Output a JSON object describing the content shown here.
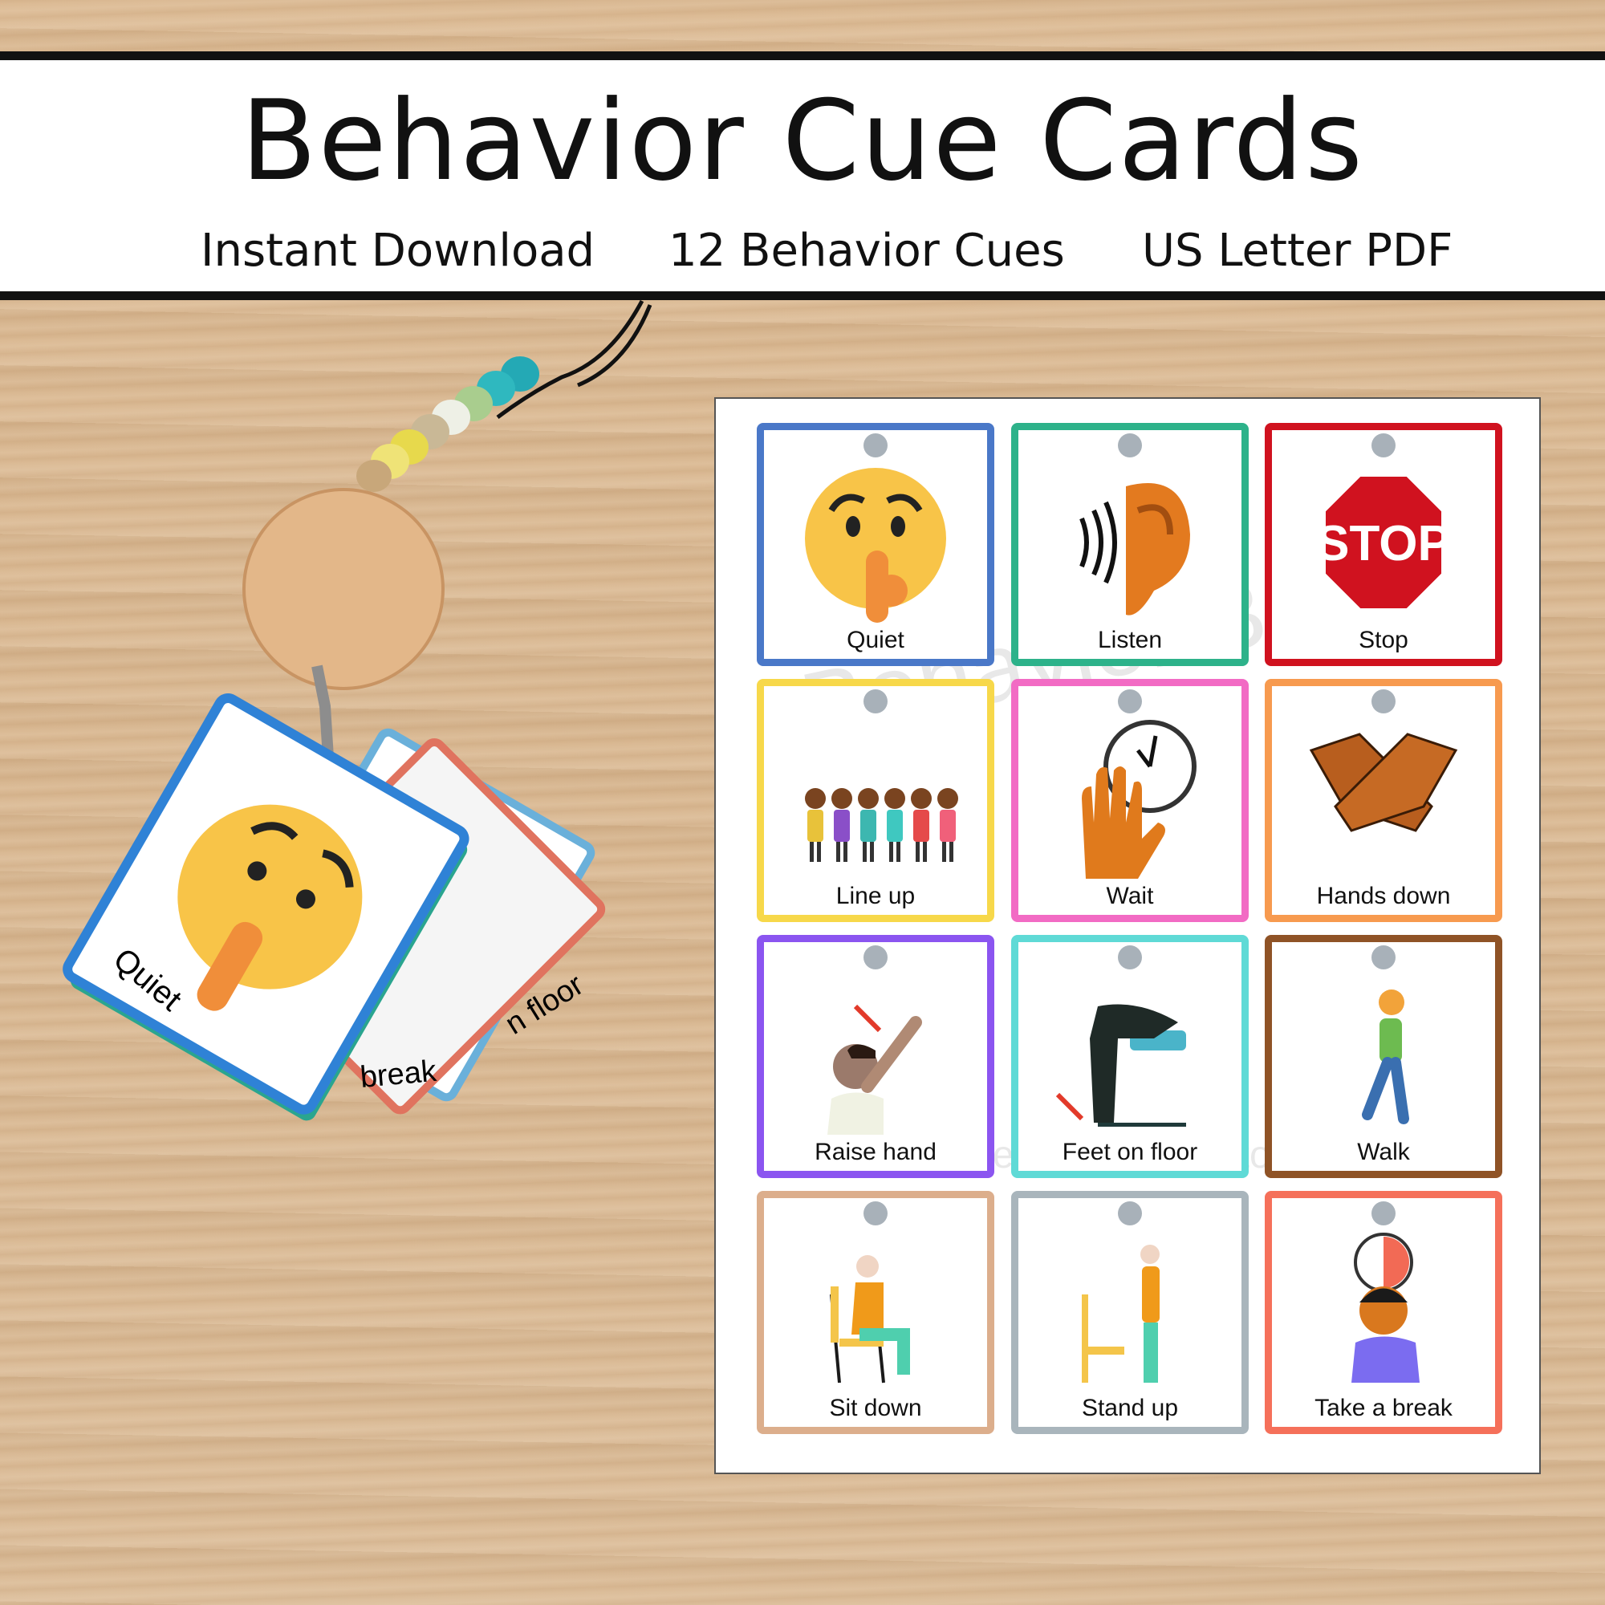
{
  "header": {
    "title": "Behavior Cue Cards",
    "features": [
      "Instant Download",
      "12 Behavior Cues",
      "US Letter PDF"
    ]
  },
  "photo": {
    "front_card_label": "Quiet",
    "back_card_labels": [
      "break",
      "n floor"
    ]
  },
  "sheet": {
    "watermark": {
      "brand_top": "The",
      "brand": "Behavior Bestie",
      "tagline": "Making behavior better together"
    },
    "cards": [
      {
        "label": "Quiet",
        "icon": "shushing-face-icon",
        "color": "#4a78c8"
      },
      {
        "label": "Listen",
        "icon": "ear-icon",
        "color": "#2db28a"
      },
      {
        "label": "Stop",
        "icon": "stop-sign-icon",
        "color": "#d0121f"
      },
      {
        "label": "Line up",
        "icon": "children-line-icon",
        "color": "#f7d84a"
      },
      {
        "label": "Wait",
        "icon": "hand-clock-icon",
        "color": "#f26bc4"
      },
      {
        "label": "Hands down",
        "icon": "crossed-hands-icon",
        "color": "#f79a4f"
      },
      {
        "label": "Raise hand",
        "icon": "raise-hand-icon",
        "color": "#8b55f0"
      },
      {
        "label": "Feet on floor",
        "icon": "feet-on-floor-icon",
        "color": "#5fdad6"
      },
      {
        "label": "Walk",
        "icon": "walking-person-icon",
        "color": "#8f5326"
      },
      {
        "label": "Sit down",
        "icon": "sitting-person-icon",
        "color": "#dcae8c"
      },
      {
        "label": "Stand up",
        "icon": "standing-person-icon",
        "color": "#a9b5bc"
      },
      {
        "label": "Take a break",
        "icon": "break-clock-icon",
        "color": "#f5705a"
      }
    ],
    "stop_sign_text": "STOP"
  }
}
